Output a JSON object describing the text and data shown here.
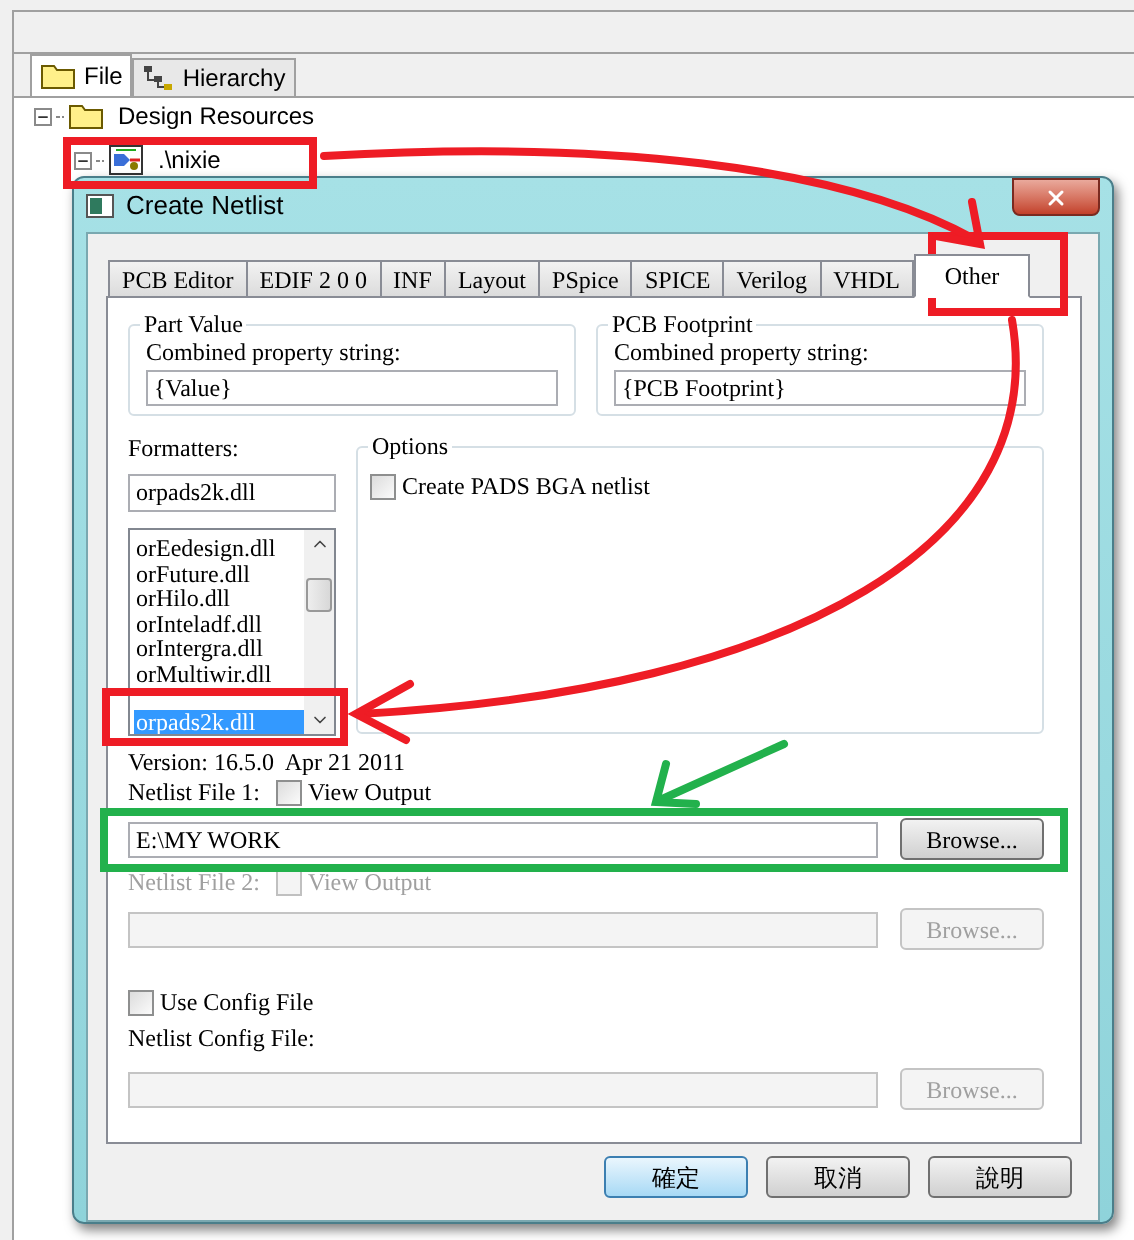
{
  "explorer": {
    "tabs": [
      {
        "label": "File",
        "kind": "folder",
        "selected": true
      },
      {
        "label": "Hierarchy",
        "kind": "hierarchy",
        "selected": false
      }
    ],
    "tree": [
      {
        "label": "Design Resources",
        "kind": "folder",
        "expanded": true,
        "children": [
          {
            "label": ".\\nixie",
            "kind": "schematic",
            "expanded": true
          }
        ]
      }
    ]
  },
  "dialog": {
    "title": "Create Netlist",
    "tabs": [
      {
        "label": "PCB Editor",
        "selected": false
      },
      {
        "label": "EDIF 2 0 0",
        "selected": false
      },
      {
        "label": "INF",
        "selected": false
      },
      {
        "label": "Layout",
        "selected": false
      },
      {
        "label": "PSpice",
        "selected": false
      },
      {
        "label": "SPICE",
        "selected": false
      },
      {
        "label": "Verilog",
        "selected": false
      },
      {
        "label": "VHDL",
        "selected": false
      },
      {
        "label": "Other",
        "selected": true
      }
    ],
    "part_value": {
      "title": "Part Value",
      "label": "Combined property string:",
      "value": "{Value}"
    },
    "pcb_footprint": {
      "title": "PCB Footprint",
      "label": "Combined property string:",
      "value": "{PCB Footprint}"
    },
    "formatters": {
      "label": "Formatters:",
      "value": "orpads2k.dll",
      "items": [
        {
          "label": "orEedesign.dll",
          "selected": false
        },
        {
          "label": "orFuture.dll",
          "selected": false
        },
        {
          "label": "orHilo.dll",
          "selected": false
        },
        {
          "label": "orInteladf.dll",
          "selected": false
        },
        {
          "label": "orIntergra.dll",
          "selected": false
        },
        {
          "label": "orMultiwir.dll",
          "selected": false
        },
        {
          "label": "orpads2k.dll",
          "selected": true
        }
      ]
    },
    "options": {
      "title": "Options",
      "checkbox": {
        "label": "Create PADS BGA netlist",
        "checked": false
      }
    },
    "version": "Version: 16.5.0  Apr 21 2011",
    "netlist_files": [
      {
        "label": "Netlist File 1:",
        "view_output": {
          "label": "View Output",
          "checked": false
        },
        "value": "E:\\MY WORK",
        "button": "Browse...",
        "disabled": false
      },
      {
        "label": "Netlist File 2:",
        "view_output": {
          "label": "View Output",
          "checked": false
        },
        "button": "Browse...",
        "disabled": true
      }
    ],
    "use_config": {
      "label": "Use Config File",
      "checked": false
    },
    "config": {
      "label": "Netlist Config File:",
      "button": "Browse...",
      "disabled": true
    },
    "buttons": [
      {
        "label": "確定",
        "default": true
      },
      {
        "label": "取消",
        "default": false
      },
      {
        "label": "說明",
        "default": false
      }
    ]
  }
}
